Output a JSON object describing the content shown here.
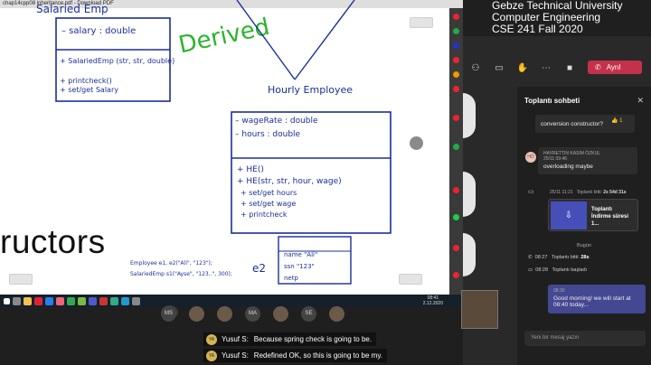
{
  "shared_screen": {
    "title_bar": "chap14cpp08 inheritance.pdf - Download PDF",
    "big_word": "ructors",
    "whiteboard": {
      "top_left_class": [
        "Salaried Emp",
        "– salary : double",
        "+ SalariedEmp (str, str, double)",
        "+ printcheck()",
        "+ set/get Salary"
      ],
      "derived_label": "Derived",
      "hourly_title": "Hourly Employee",
      "hourly_fields": [
        "– wageRate : double",
        "– hours : double"
      ],
      "hourly_methods": [
        "+ HE()",
        "+ HE(str, str, hour, wage)",
        "+ set/get hours",
        "+ set/get wage",
        "+ printcheck"
      ],
      "code_lines": [
        "Employee e1, e2(\"Ali\", \"123\");",
        "SalariedEmp s1(\"Ayse\", \"123..\", 300);"
      ],
      "e2_label": "e2",
      "e2_box": [
        "name \"Ali\"",
        "ssn  \"123\"",
        "netp"
      ]
    },
    "taskbar_clock": [
      "08:41",
      "2.12.2020"
    ]
  },
  "course_overlay": [
    "Gebze Technical University",
    "Computer Engineering",
    "CSE 241 Fall 2020"
  ],
  "meeting_controls": {
    "leave_label": "Ayrıl",
    "icons": [
      "people-icon",
      "chat-icon",
      "hand-icon",
      "more-icon",
      "camera-icon",
      "mic-icon",
      "share-icon"
    ]
  },
  "chat": {
    "title": "Toplantı sohbeti",
    "messages": [
      {
        "author": "",
        "time": "",
        "text": "conversion constructor?",
        "reaction": "1"
      },
      {
        "author": "HAYRETTIN KASIM ÖZKUL",
        "initials": "HÖ",
        "time": "25/11 09:46",
        "text": "overloading maybe"
      }
    ],
    "recording": {
      "time": "25/11 11:21",
      "status": "Toplantı bitti:",
      "duration": "2s 54d 31s",
      "name_line1": "Toplantı",
      "name_line2": "İndirme süresi 1..."
    },
    "day_divider": "Bugün",
    "system_lines": [
      {
        "time": "08:27",
        "text": "Toplantı bitti:",
        "value": "28s"
      },
      {
        "time": "08:28",
        "text": "Toplantı başladı",
        "value": ""
      }
    ],
    "own_message": {
      "time": "08:30",
      "text": "Good morning! we will start at 08:40 today..."
    },
    "input_placeholder": "Yeni bir mesaj yazın"
  },
  "participants": {
    "more_count": "+44",
    "initials": [
      "MS",
      "",
      "",
      "MA",
      "",
      "SE",
      ""
    ]
  },
  "subtitles": [
    {
      "initials": "YA",
      "speaker": "Yusuf S:",
      "text": "Because spring check is going to be."
    },
    {
      "initials": "YA",
      "speaker": "Yusuf S:",
      "text": "Redefined OK, so this is going to be my."
    }
  ]
}
